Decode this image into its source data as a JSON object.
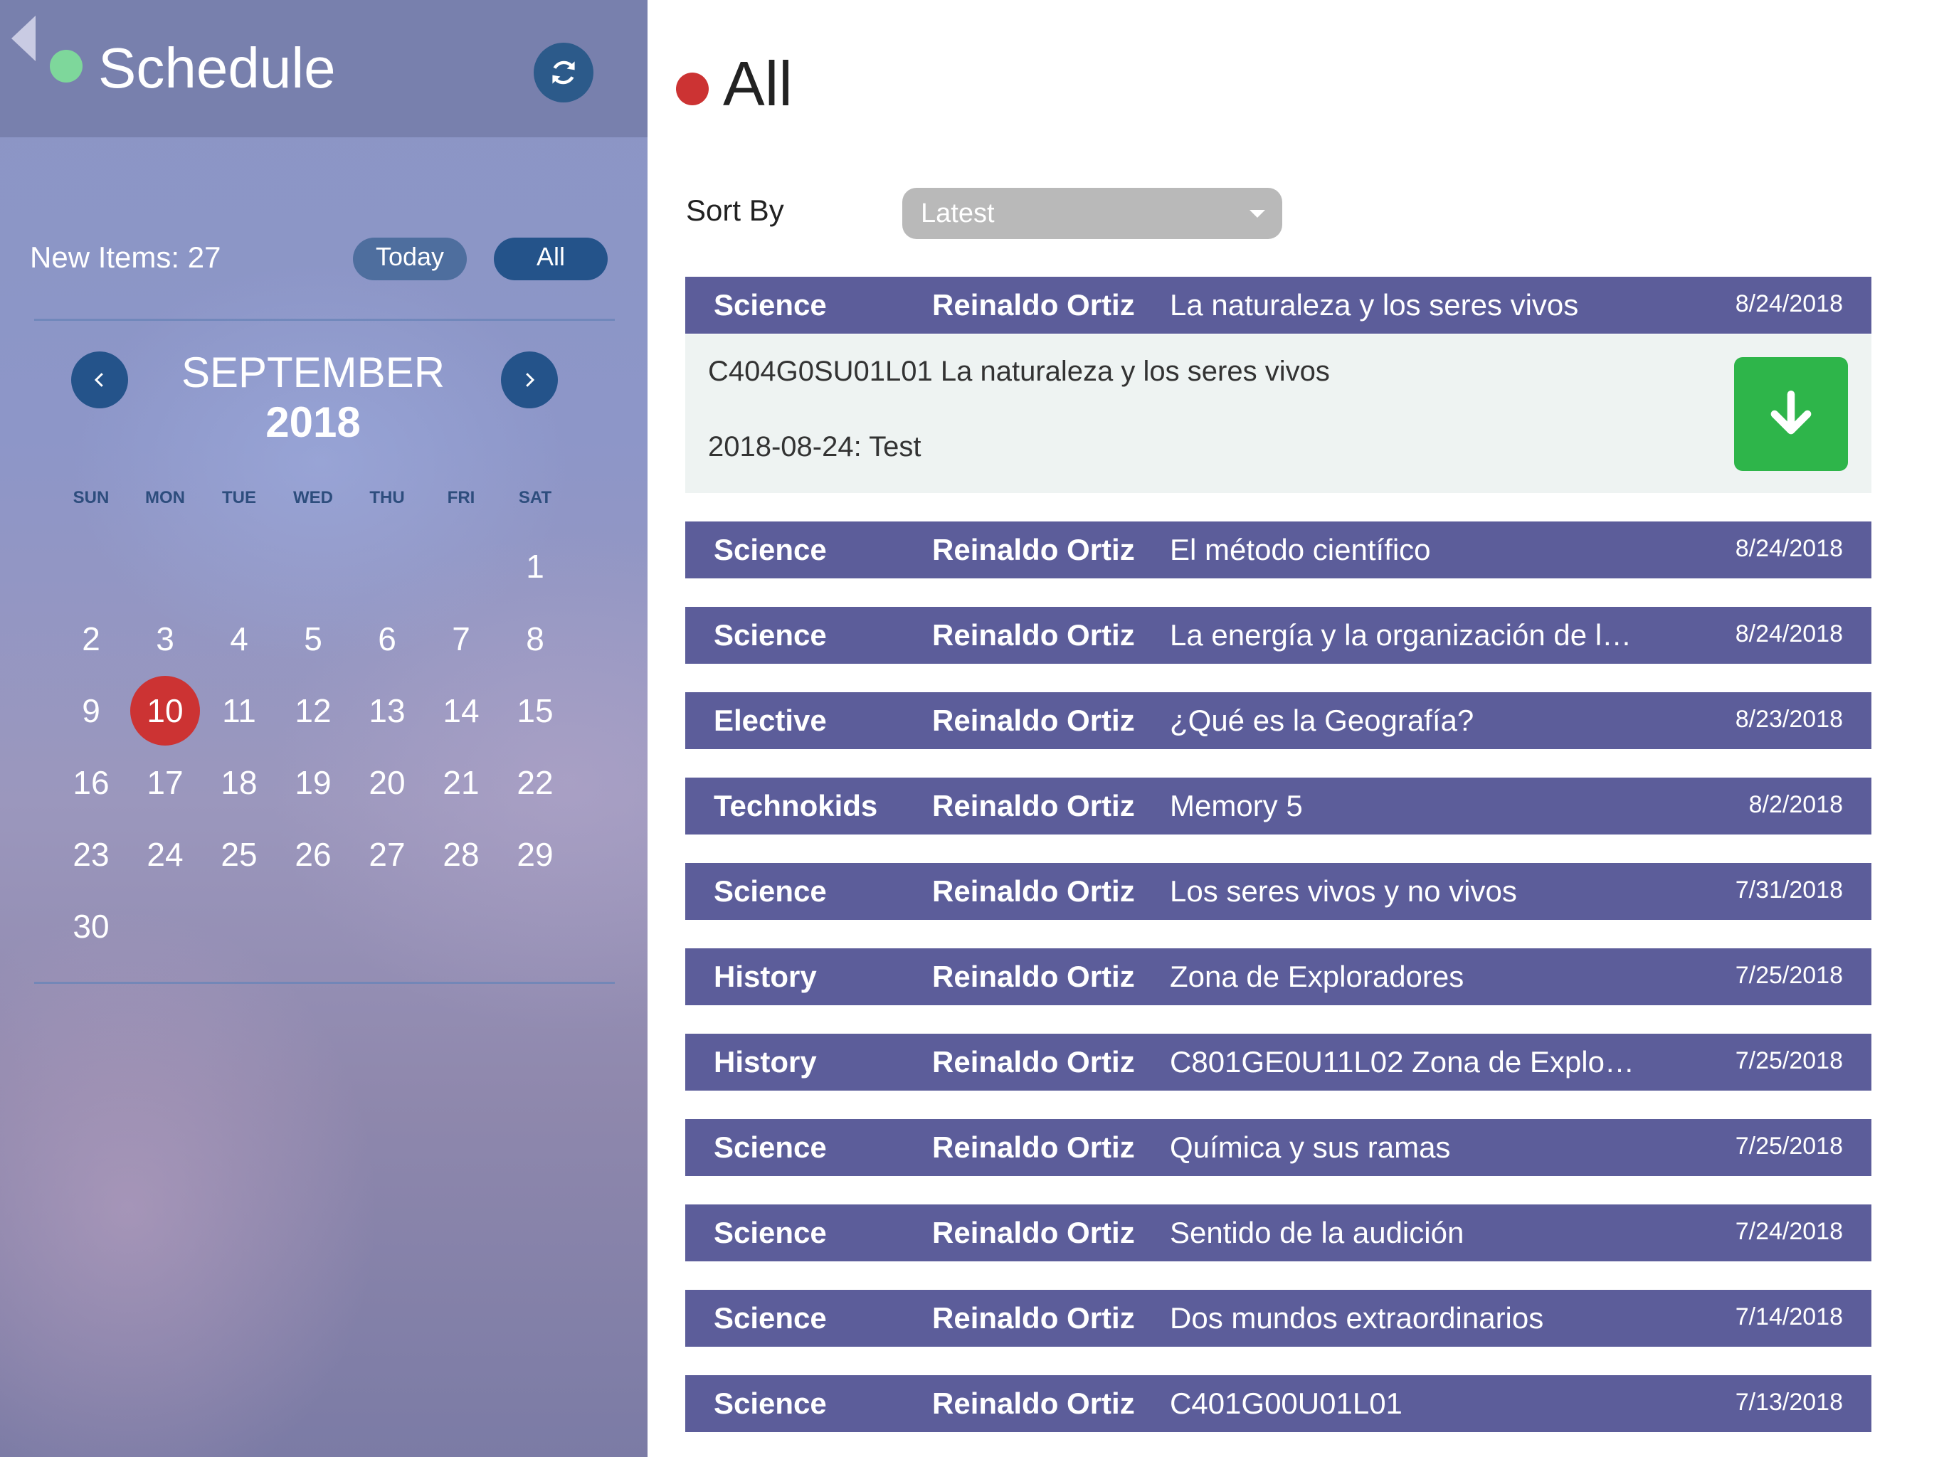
{
  "sidebar": {
    "title": "Schedule",
    "new_items": "New Items: 27",
    "today_label": "Today",
    "all_label": "All",
    "calendar": {
      "month": "SEPTEMBER",
      "year": "2018",
      "weekdays": [
        "SUN",
        "MON",
        "TUE",
        "WED",
        "THU",
        "FRI",
        "SAT"
      ],
      "days": [
        "1",
        "2",
        "3",
        "4",
        "5",
        "6",
        "7",
        "8",
        "9",
        "10",
        "11",
        "12",
        "13",
        "14",
        "15",
        "16",
        "17",
        "18",
        "19",
        "20",
        "21",
        "22",
        "23",
        "24",
        "25",
        "26",
        "27",
        "28",
        "29",
        "30"
      ],
      "first_weekday": 6,
      "selected_day": "10"
    }
  },
  "main": {
    "title": "All",
    "sort_label": "Sort By",
    "sort_value": "Latest",
    "detail": {
      "line1": "C404G0SU01L01 La naturaleza y los seres vivos",
      "line2": "2018-08-24: Test"
    },
    "items": [
      {
        "category": "Science",
        "author": "Reinaldo Ortiz",
        "title": "La naturaleza y los seres vivos",
        "date": "8/24/2018"
      },
      {
        "category": "Science",
        "author": "Reinaldo Ortiz",
        "title": "El método científico",
        "date": "8/24/2018"
      },
      {
        "category": "Science",
        "author": "Reinaldo Ortiz",
        "title": "La energía y la organización de l…",
        "date": "8/24/2018"
      },
      {
        "category": "Elective",
        "author": "Reinaldo Ortiz",
        "title": "¿Qué es la Geografía?",
        "date": "8/23/2018"
      },
      {
        "category": "Technokids",
        "author": "Reinaldo Ortiz",
        "title": "Memory 5",
        "date": "8/2/2018"
      },
      {
        "category": "Science",
        "author": "Reinaldo Ortiz",
        "title": "Los seres vivos y no vivos",
        "date": "7/31/2018"
      },
      {
        "category": "History",
        "author": "Reinaldo Ortiz",
        "title": "Zona de Exploradores",
        "date": "7/25/2018"
      },
      {
        "category": "History",
        "author": "Reinaldo Ortiz",
        "title": "C801GE0U11L02 Zona de Explo…",
        "date": "7/25/2018"
      },
      {
        "category": "Science",
        "author": "Reinaldo Ortiz",
        "title": "Química y sus ramas",
        "date": "7/25/2018"
      },
      {
        "category": "Science",
        "author": "Reinaldo Ortiz",
        "title": "Sentido de la audición",
        "date": "7/24/2018"
      },
      {
        "category": "Science",
        "author": "Reinaldo Ortiz",
        "title": "Dos mundos extraordinarios",
        "date": "7/14/2018"
      },
      {
        "category": "Science",
        "author": "Reinaldo Ortiz",
        "title": "C401G00U01L01",
        "date": "7/13/2018"
      }
    ]
  },
  "icons": {
    "back": "back-arrow-icon",
    "refresh": "refresh-icon",
    "prev_month": "chevron-left-icon",
    "next_month": "chevron-right-icon",
    "download": "download-icon",
    "sort_caret": "caret-down-icon"
  },
  "colors": {
    "status_green": "#7ed79b",
    "status_red": "#cc3333",
    "row_bg": "#5c5d9a",
    "button_blue": "#24538a",
    "download_green": "#2eb54a"
  }
}
